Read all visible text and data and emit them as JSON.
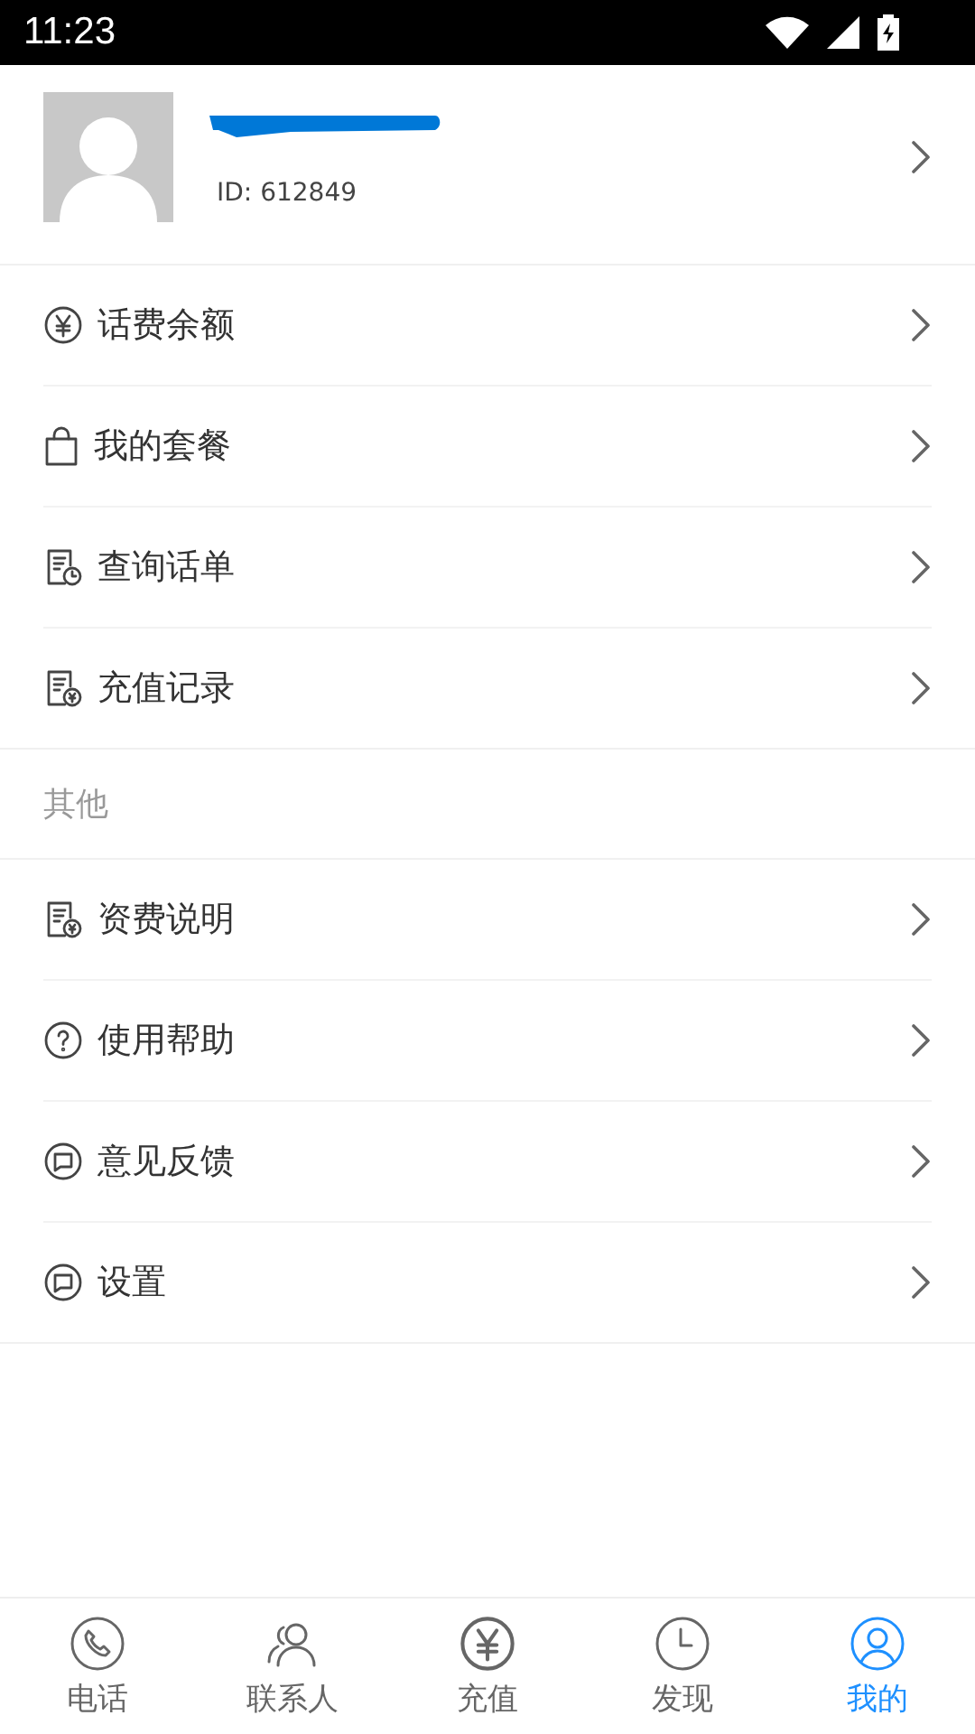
{
  "status_bar": {
    "time": "11:23"
  },
  "profile": {
    "id_label": "ID: 612849"
  },
  "menu": [
    {
      "label": "话费余额"
    },
    {
      "label": "我的套餐"
    },
    {
      "label": "查询话单"
    },
    {
      "label": "充值记录"
    }
  ],
  "other_section": {
    "title": "其他",
    "items": [
      {
        "label": "资费说明"
      },
      {
        "label": "使用帮助"
      },
      {
        "label": "意见反馈"
      },
      {
        "label": "设置"
      }
    ]
  },
  "tab_bar": [
    {
      "label": "电话",
      "selected": false
    },
    {
      "label": "联系人",
      "selected": false
    },
    {
      "label": "充值",
      "selected": false
    },
    {
      "label": "发现",
      "selected": false
    },
    {
      "label": "我的",
      "selected": true
    }
  ]
}
